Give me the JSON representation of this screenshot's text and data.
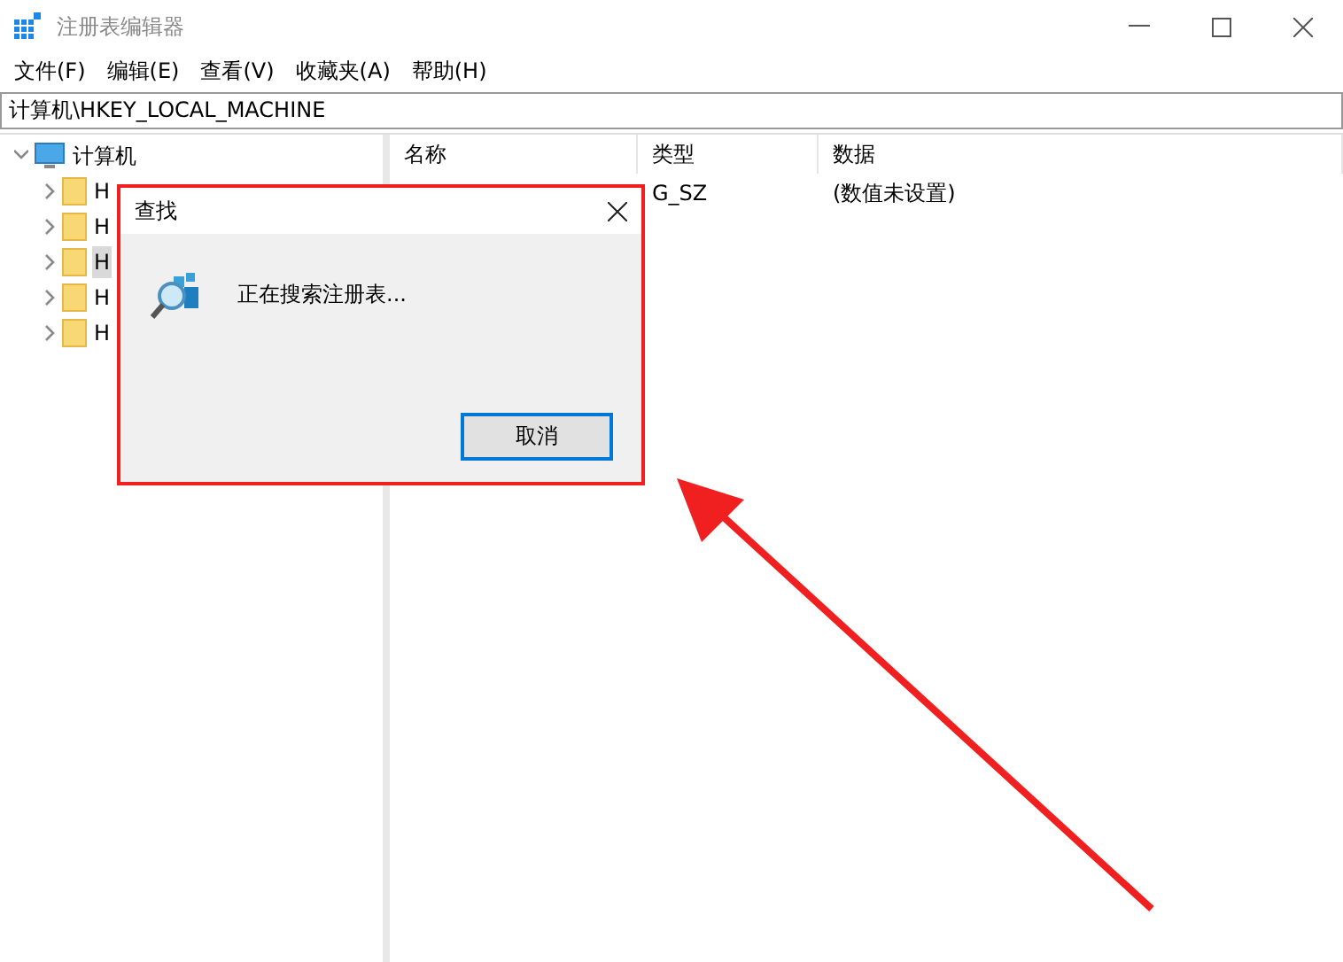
{
  "window": {
    "title": "注册表编辑器"
  },
  "menu": [
    "文件(F)",
    "编辑(E)",
    "查看(V)",
    "收藏夹(A)",
    "帮助(H)"
  ],
  "address": "计算机\\HKEY_LOCAL_MACHINE",
  "tree": {
    "label": "计算机",
    "expanded": true,
    "children": [
      {
        "label": "H",
        "selected": false
      },
      {
        "label": "H",
        "selected": false
      },
      {
        "label": "H",
        "selected": true
      },
      {
        "label": "H",
        "selected": false
      },
      {
        "label": "H",
        "selected": false
      }
    ]
  },
  "table": {
    "columns": [
      "名称",
      "类型",
      "数据"
    ],
    "rows": [
      {
        "cells": [
          "",
          "G_SZ",
          "(数值未设置)"
        ]
      }
    ]
  },
  "dialog": {
    "title": "查找",
    "message": "正在搜索注册表...",
    "button": "取消"
  }
}
